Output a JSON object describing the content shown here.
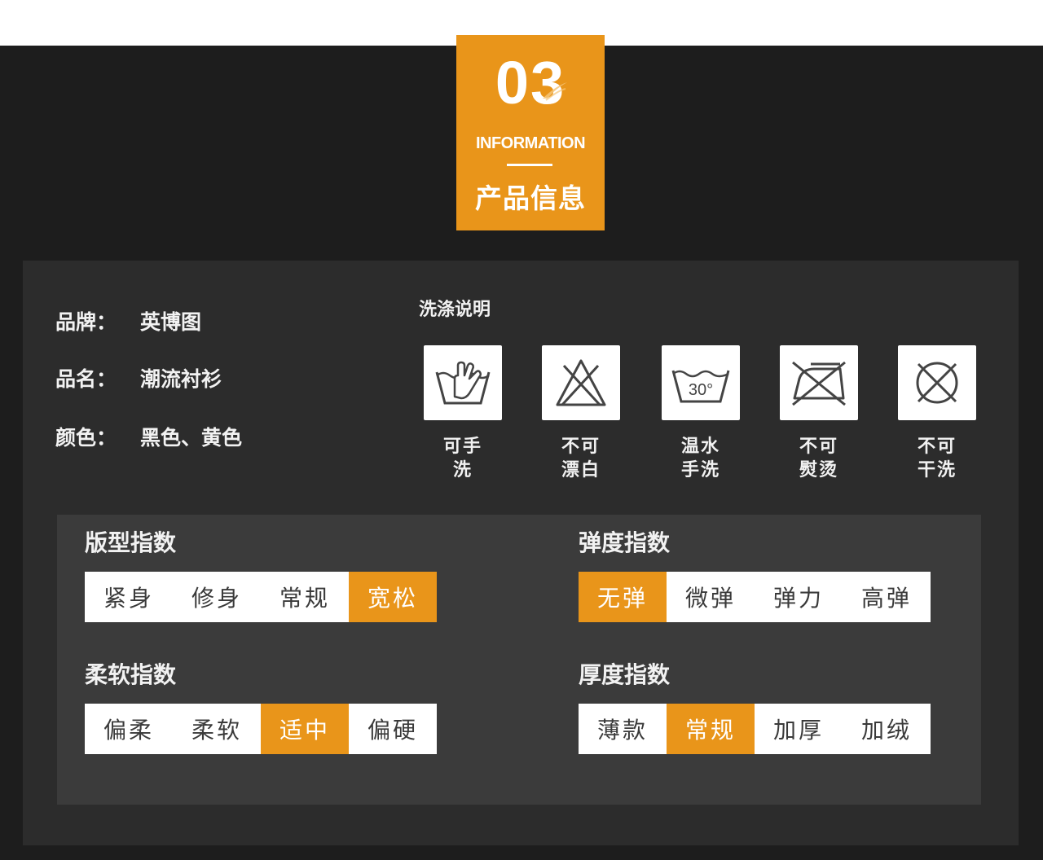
{
  "header": {
    "number": "03",
    "subtitle_en": "INFORMATION",
    "title_cn": "产品信息",
    "accent_color": "#e9951a"
  },
  "specs": [
    {
      "label": "品牌：",
      "value": "英博图"
    },
    {
      "label": "品名：",
      "value": "潮流衬衫"
    },
    {
      "label": "颜色：",
      "value": "黑色、黄色"
    }
  ],
  "wash": {
    "title": "洗涤说明",
    "items": [
      {
        "icon": "hand-wash-icon",
        "label": "可手洗"
      },
      {
        "icon": "no-bleach-icon",
        "label": "不可漂白"
      },
      {
        "icon": "wash-30-icon",
        "icon_text": "30°",
        "label": "温水手洗"
      },
      {
        "icon": "no-iron-icon",
        "label": "不可熨烫"
      },
      {
        "icon": "no-dry-clean-icon",
        "label": "不可干洗"
      }
    ]
  },
  "indices": [
    {
      "title": "版型指数",
      "options": [
        "紧身",
        "修身",
        "常规",
        "宽松"
      ],
      "selected": "宽松"
    },
    {
      "title": "弹度指数",
      "options": [
        "无弹",
        "微弹",
        "弹力",
        "高弹"
      ],
      "selected": "无弹"
    },
    {
      "title": "柔软指数",
      "options": [
        "偏柔",
        "柔软",
        "适中",
        "偏硬"
      ],
      "selected": "适中"
    },
    {
      "title": "厚度指数",
      "options": [
        "薄款",
        "常规",
        "加厚",
        "加绒"
      ],
      "selected": "常规"
    }
  ]
}
